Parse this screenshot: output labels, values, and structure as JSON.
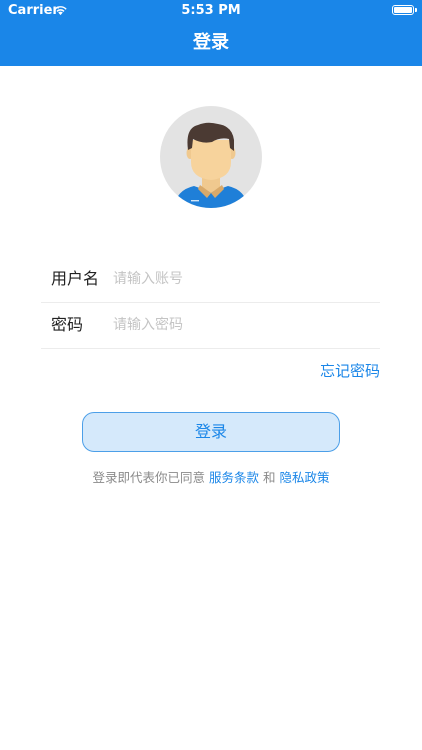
{
  "status_bar": {
    "carrier": "Carrier",
    "time": "5:53 PM"
  },
  "nav": {
    "title": "登录"
  },
  "form": {
    "username": {
      "label": "用户名",
      "placeholder": "请输入账号",
      "value": ""
    },
    "password": {
      "label": "密码",
      "placeholder": "请输入密码",
      "value": ""
    }
  },
  "forgot_password": "忘记密码",
  "login_button": "登录",
  "agreement": {
    "prefix": "登录即代表你已同意",
    "terms_link": "服务条款",
    "conjunction": "和",
    "privacy_link": "隐私政策"
  },
  "colors": {
    "primary": "#1a86e8",
    "button_bg": "#d5e9fb",
    "placeholder": "#c4c4c4",
    "muted_text": "#8a8a8a"
  },
  "icons": {
    "wifi": "wifi-icon",
    "battery": "battery-icon",
    "avatar": "default-user-avatar"
  }
}
